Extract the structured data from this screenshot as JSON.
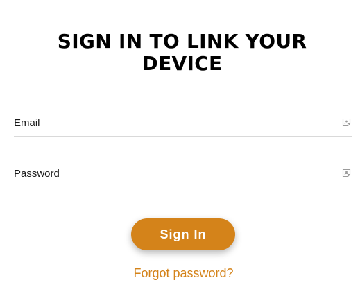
{
  "heading": "SIGN IN TO LINK YOUR DEVICE",
  "form": {
    "email": {
      "placeholder": "Email",
      "value": "",
      "icon": "autofill-card-icon"
    },
    "password": {
      "placeholder": "Password",
      "value": "",
      "icon": "autofill-card-icon"
    },
    "submit_label": "Sign In",
    "forgot_label": "Forgot password?"
  },
  "colors": {
    "accent": "#d4831a",
    "text": "#000000",
    "divider": "#d9d9d9",
    "icon": "#9a9a9a"
  }
}
